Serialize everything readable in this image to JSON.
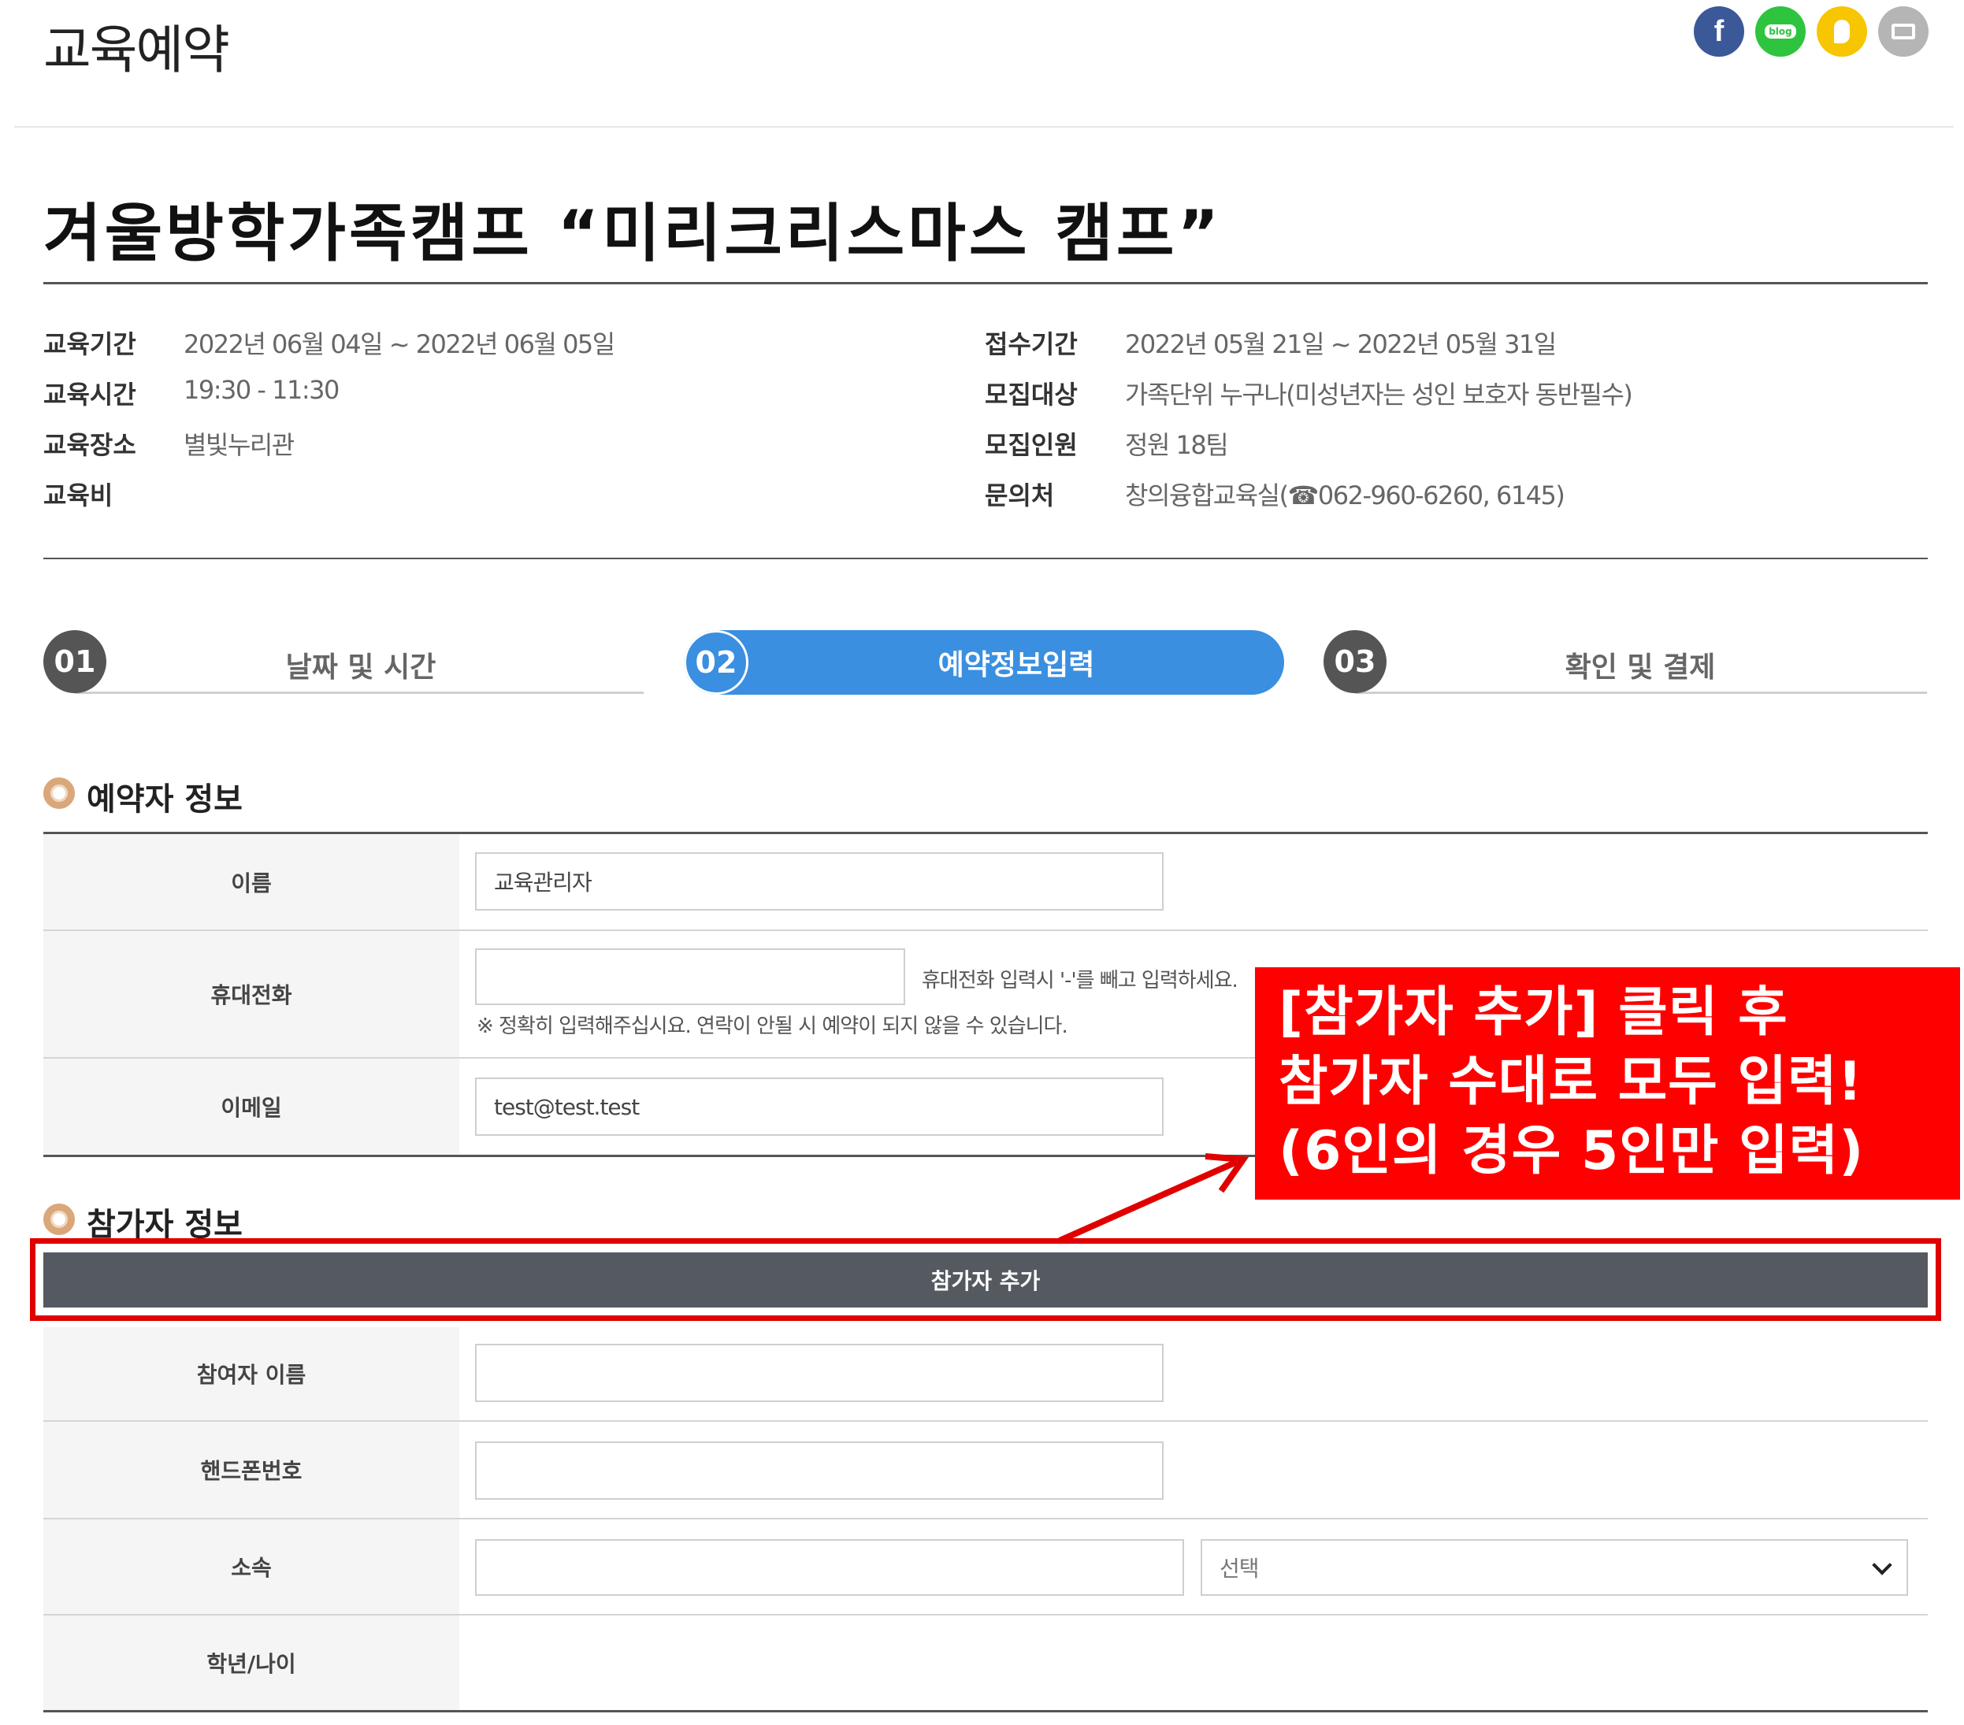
{
  "page": {
    "title": "교육예약"
  },
  "share": {
    "facebook": "f",
    "blog": "blog"
  },
  "course": {
    "title": "겨울방학가족캠프 “미리크리스마스 캠프”"
  },
  "info": {
    "left": [
      {
        "label": "교육기간",
        "value": "2022년 06월 04일 ~ 2022년 06월 05일"
      },
      {
        "label": "교육시간",
        "value": "19:30 - 11:30"
      },
      {
        "label": "교육장소",
        "value": "별빛누리관"
      },
      {
        "label": "교육비",
        "value": ""
      }
    ],
    "right": [
      {
        "label": "접수기간",
        "value": "2022년 05월 21일 ~ 2022년 05월 31일"
      },
      {
        "label": "모집대상",
        "value": "가족단위 누구나(미성년자는 성인 보호자 동반필수)"
      },
      {
        "label": "모집인원",
        "value": "정원 18팀"
      },
      {
        "label": "문의처",
        "value": "창의융합교육실(☎062-960-6260, 6145)"
      }
    ]
  },
  "steps": [
    {
      "num": "01",
      "label": "날짜 및 시간",
      "active": false
    },
    {
      "num": "02",
      "label": "예약정보입력",
      "active": true
    },
    {
      "num": "03",
      "label": "확인 및 결제",
      "active": false
    }
  ],
  "reserver": {
    "section_title": "예약자 정보",
    "name_label": "이름",
    "name_value": "교육관리자",
    "phone_label": "휴대전화",
    "phone_value": "",
    "phone_hint": "휴대전화 입력시 '-'를 빼고 입력하세요.",
    "phone_note": "※ 정확히 입력해주십시요. 연락이 안될 시 예약이 되지 않을 수 있습니다.",
    "email_label": "이메일",
    "email_value": "test@test.test"
  },
  "participant": {
    "section_title": "참가자 정보",
    "add_button": "참가자 추가",
    "name_label": "참여자 이름",
    "phone_label": "핸드폰번호",
    "org_label": "소속",
    "org_select": "선택",
    "grade_label": "학년/나이"
  },
  "callout": {
    "line1": "[참가자 추가] 클릭 후",
    "line2": "참가자 수대로 모두 입력!",
    "line3": "(6인의 경우 5인만 입력)"
  },
  "colors": {
    "accent": "#3a8fe0",
    "annotation": "#ff0000",
    "button": "#555a61"
  }
}
